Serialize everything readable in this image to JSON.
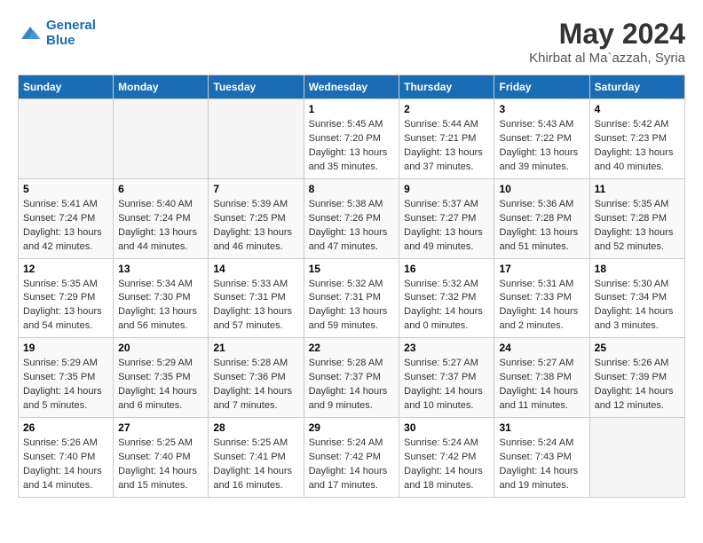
{
  "logo": {
    "line1": "General",
    "line2": "Blue"
  },
  "title": "May 2024",
  "location": "Khirbat al Ma`azzah, Syria",
  "headers": [
    "Sunday",
    "Monday",
    "Tuesday",
    "Wednesday",
    "Thursday",
    "Friday",
    "Saturday"
  ],
  "weeks": [
    [
      {
        "day": "",
        "empty": true
      },
      {
        "day": "",
        "empty": true
      },
      {
        "day": "",
        "empty": true
      },
      {
        "day": "1",
        "sunrise": "5:45 AM",
        "sunset": "7:20 PM",
        "daylight": "13 hours and 35 minutes."
      },
      {
        "day": "2",
        "sunrise": "5:44 AM",
        "sunset": "7:21 PM",
        "daylight": "13 hours and 37 minutes."
      },
      {
        "day": "3",
        "sunrise": "5:43 AM",
        "sunset": "7:22 PM",
        "daylight": "13 hours and 39 minutes."
      },
      {
        "day": "4",
        "sunrise": "5:42 AM",
        "sunset": "7:23 PM",
        "daylight": "13 hours and 40 minutes."
      }
    ],
    [
      {
        "day": "5",
        "sunrise": "5:41 AM",
        "sunset": "7:24 PM",
        "daylight": "13 hours and 42 minutes."
      },
      {
        "day": "6",
        "sunrise": "5:40 AM",
        "sunset": "7:24 PM",
        "daylight": "13 hours and 44 minutes."
      },
      {
        "day": "7",
        "sunrise": "5:39 AM",
        "sunset": "7:25 PM",
        "daylight": "13 hours and 46 minutes."
      },
      {
        "day": "8",
        "sunrise": "5:38 AM",
        "sunset": "7:26 PM",
        "daylight": "13 hours and 47 minutes."
      },
      {
        "day": "9",
        "sunrise": "5:37 AM",
        "sunset": "7:27 PM",
        "daylight": "13 hours and 49 minutes."
      },
      {
        "day": "10",
        "sunrise": "5:36 AM",
        "sunset": "7:28 PM",
        "daylight": "13 hours and 51 minutes."
      },
      {
        "day": "11",
        "sunrise": "5:35 AM",
        "sunset": "7:28 PM",
        "daylight": "13 hours and 52 minutes."
      }
    ],
    [
      {
        "day": "12",
        "sunrise": "5:35 AM",
        "sunset": "7:29 PM",
        "daylight": "13 hours and 54 minutes."
      },
      {
        "day": "13",
        "sunrise": "5:34 AM",
        "sunset": "7:30 PM",
        "daylight": "13 hours and 56 minutes."
      },
      {
        "day": "14",
        "sunrise": "5:33 AM",
        "sunset": "7:31 PM",
        "daylight": "13 hours and 57 minutes."
      },
      {
        "day": "15",
        "sunrise": "5:32 AM",
        "sunset": "7:31 PM",
        "daylight": "13 hours and 59 minutes."
      },
      {
        "day": "16",
        "sunrise": "5:32 AM",
        "sunset": "7:32 PM",
        "daylight": "14 hours and 0 minutes."
      },
      {
        "day": "17",
        "sunrise": "5:31 AM",
        "sunset": "7:33 PM",
        "daylight": "14 hours and 2 minutes."
      },
      {
        "day": "18",
        "sunrise": "5:30 AM",
        "sunset": "7:34 PM",
        "daylight": "14 hours and 3 minutes."
      }
    ],
    [
      {
        "day": "19",
        "sunrise": "5:29 AM",
        "sunset": "7:35 PM",
        "daylight": "14 hours and 5 minutes."
      },
      {
        "day": "20",
        "sunrise": "5:29 AM",
        "sunset": "7:35 PM",
        "daylight": "14 hours and 6 minutes."
      },
      {
        "day": "21",
        "sunrise": "5:28 AM",
        "sunset": "7:36 PM",
        "daylight": "14 hours and 7 minutes."
      },
      {
        "day": "22",
        "sunrise": "5:28 AM",
        "sunset": "7:37 PM",
        "daylight": "14 hours and 9 minutes."
      },
      {
        "day": "23",
        "sunrise": "5:27 AM",
        "sunset": "7:37 PM",
        "daylight": "14 hours and 10 minutes."
      },
      {
        "day": "24",
        "sunrise": "5:27 AM",
        "sunset": "7:38 PM",
        "daylight": "14 hours and 11 minutes."
      },
      {
        "day": "25",
        "sunrise": "5:26 AM",
        "sunset": "7:39 PM",
        "daylight": "14 hours and 12 minutes."
      }
    ],
    [
      {
        "day": "26",
        "sunrise": "5:26 AM",
        "sunset": "7:40 PM",
        "daylight": "14 hours and 14 minutes."
      },
      {
        "day": "27",
        "sunrise": "5:25 AM",
        "sunset": "7:40 PM",
        "daylight": "14 hours and 15 minutes."
      },
      {
        "day": "28",
        "sunrise": "5:25 AM",
        "sunset": "7:41 PM",
        "daylight": "14 hours and 16 minutes."
      },
      {
        "day": "29",
        "sunrise": "5:24 AM",
        "sunset": "7:42 PM",
        "daylight": "14 hours and 17 minutes."
      },
      {
        "day": "30",
        "sunrise": "5:24 AM",
        "sunset": "7:42 PM",
        "daylight": "14 hours and 18 minutes."
      },
      {
        "day": "31",
        "sunrise": "5:24 AM",
        "sunset": "7:43 PM",
        "daylight": "14 hours and 19 minutes."
      },
      {
        "day": "",
        "empty": true
      }
    ]
  ]
}
